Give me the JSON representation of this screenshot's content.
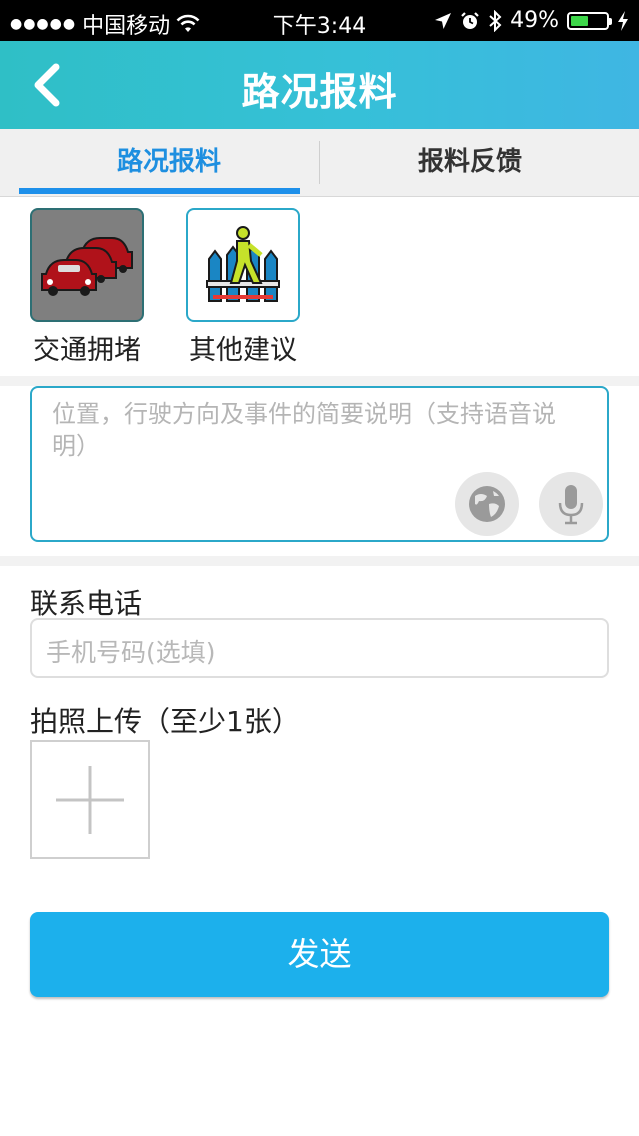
{
  "status_bar": {
    "signal_dots": "●●●●●",
    "carrier": "中国移动",
    "time": "下午3:44",
    "battery_percent": "49%",
    "battery_level": 0.49,
    "battery_color": "#3ed64a"
  },
  "navbar": {
    "title": "路况报料",
    "back_icon": "chevron-left-icon"
  },
  "tabs": [
    {
      "label": "路况报料",
      "active": true
    },
    {
      "label": "报料反馈",
      "active": false
    }
  ],
  "categories": [
    {
      "label": "交通拥堵",
      "icon": "traffic-jam-icon",
      "selected": true
    },
    {
      "label": "其他建议",
      "icon": "other-suggestion-icon",
      "selected": false
    }
  ],
  "description": {
    "placeholder": "位置，行驶方向及事件的简要说明（支持语音说明）",
    "location_icon": "globe-icon",
    "voice_icon": "microphone-icon"
  },
  "contact": {
    "label": "联系电话",
    "placeholder": "手机号码(选填)"
  },
  "photo": {
    "label": "拍照上传（至少1张）",
    "add_icon": "plus-icon"
  },
  "send_button": "发送",
  "colors": {
    "accent": "#1e8fe0",
    "button": "#1cb0ec",
    "border_accent": "#2ba8c9"
  }
}
